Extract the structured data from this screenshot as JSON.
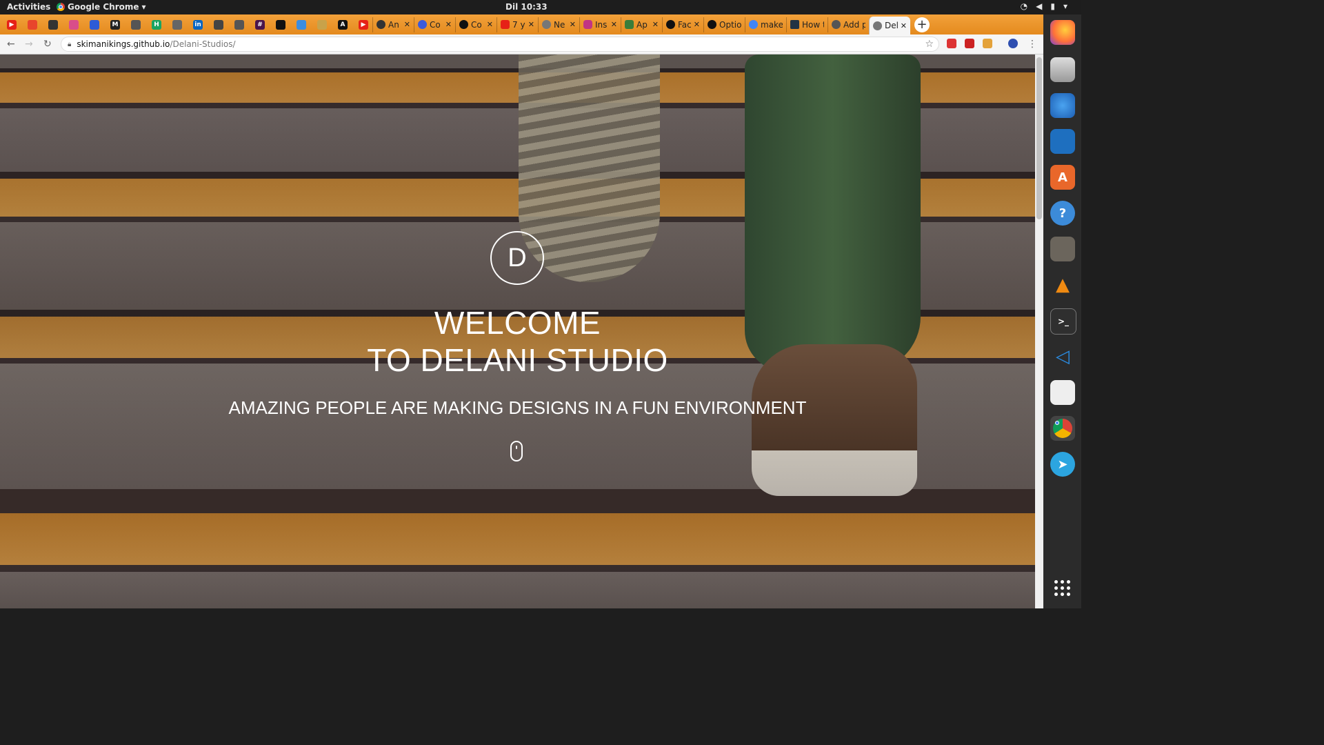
{
  "system": {
    "activities": "Activities",
    "app_name": "Google Chrome",
    "clock": "Dil 10:33"
  },
  "tabs": [
    {
      "title": "An"
    },
    {
      "title": "Co"
    },
    {
      "title": "Co"
    },
    {
      "title": "7 y"
    },
    {
      "title": "Ne"
    },
    {
      "title": "Ins"
    },
    {
      "title": "Ap"
    },
    {
      "title": "Fac"
    },
    {
      "title": "Optio"
    },
    {
      "title": "make"
    },
    {
      "title": "How t"
    },
    {
      "title": "Add p"
    },
    {
      "title": "Del"
    }
  ],
  "address": {
    "host": "skimanikings.github.io",
    "path": "/Delani-Studios/"
  },
  "hero": {
    "logo_letter": "D",
    "welcome_line1": "WELCOME",
    "welcome_line2": "TO DELANI STUDIO",
    "tagline": "AMAZING PEOPLE ARE MAKING DESIGNS IN A FUN ENVIRONMENT"
  },
  "dock": {
    "items": [
      "firefox-icon",
      "files-icon",
      "thunderbird-icon",
      "writer-icon",
      "software-icon",
      "help-icon",
      "gimp-icon",
      "vlc-icon",
      "terminal-icon",
      "vscode-icon",
      "screenshot-icon",
      "chrome-icon",
      "telegram-icon"
    ]
  }
}
